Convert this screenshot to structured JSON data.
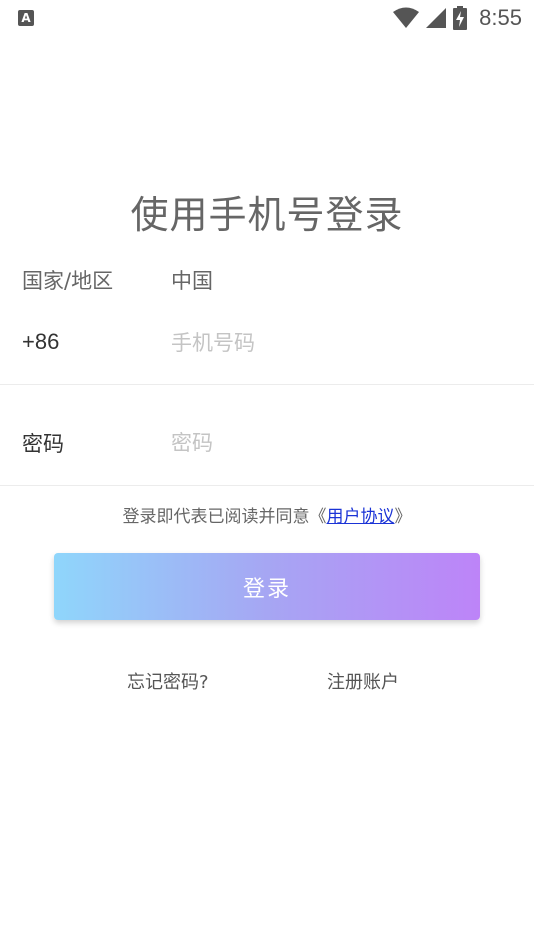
{
  "status_bar": {
    "app_icon_letter": "A",
    "time": "8:55",
    "icons": [
      "wifi-icon",
      "signal-icon",
      "battery-charging-icon"
    ]
  },
  "title": "使用手机号登录",
  "region": {
    "label": "国家/地区",
    "value": "中国"
  },
  "phone": {
    "country_code": "+86",
    "placeholder": "手机号码",
    "value": ""
  },
  "password": {
    "label": "密码",
    "placeholder": "密码",
    "value": ""
  },
  "agreement": {
    "prefix": "登录即代表已阅读并同意《",
    "link_text": "用户协议",
    "suffix": "》",
    "link_color": "#1a33d6"
  },
  "login_button": {
    "label": "登录",
    "gradient": [
      "#8fd6fb",
      "#bd84f8"
    ]
  },
  "links": {
    "forgot_password": "忘记密码?",
    "register": "注册账户"
  }
}
